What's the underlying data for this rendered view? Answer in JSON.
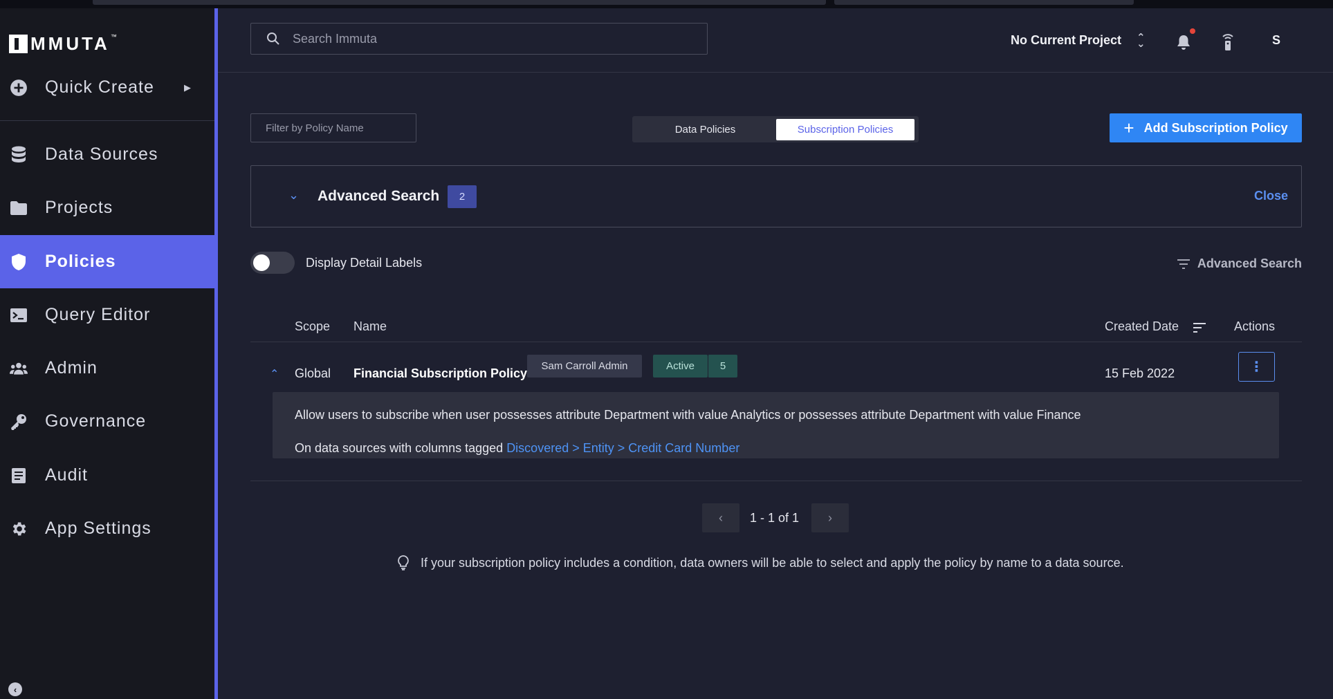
{
  "app": {
    "logo_text": "MMUTA",
    "logo_tm": "™"
  },
  "sidebar": {
    "items": [
      {
        "label": "Quick Create",
        "icon": "plus-circle-icon"
      },
      {
        "label": "Data Sources",
        "icon": "database-icon"
      },
      {
        "label": "Projects",
        "icon": "folder-icon"
      },
      {
        "label": "Policies",
        "icon": "shield-icon",
        "active": true
      },
      {
        "label": "Query Editor",
        "icon": "terminal-icon"
      },
      {
        "label": "Admin",
        "icon": "users-icon"
      },
      {
        "label": "Governance",
        "icon": "key-icon"
      },
      {
        "label": "Audit",
        "icon": "audit-icon"
      },
      {
        "label": "App Settings",
        "icon": "gear-icon"
      }
    ]
  },
  "header": {
    "search_placeholder": "Search Immuta",
    "project": "No Current Project",
    "user_initial": "S"
  },
  "toolbar": {
    "filter_placeholder": "Filter by Policy Name",
    "tab_data": "Data Policies",
    "tab_subscription": "Subscription Policies",
    "add_button": "Add Subscription Policy"
  },
  "advanced": {
    "title": "Advanced Search",
    "count": "2",
    "close": "Close",
    "toggle_label": "Display Detail Labels",
    "link": "Advanced Search"
  },
  "table": {
    "headers": {
      "scope": "Scope",
      "name": "Name",
      "created": "Created Date",
      "actions": "Actions"
    },
    "rows": [
      {
        "scope": "Global",
        "name": "Financial Subscription Policy",
        "owner": "Sam Carroll Admin",
        "status": "Active",
        "count": "5",
        "created": "15 Feb 2022",
        "detail_line1": "Allow users to subscribe when user possesses attribute Department with value Analytics or possesses attribute Department with value Finance",
        "detail_line2_prefix": "On data sources with columns tagged",
        "detail_line2_link": "Discovered > Entity > Credit Card Number"
      }
    ]
  },
  "pager": {
    "text": "1 - 1 of 1"
  },
  "hint": "If your subscription policy includes a condition, data owners will be able to select and apply the policy by name to a data source.",
  "colors": {
    "accent": "#5b63e8",
    "primary_button": "#2f86f4",
    "link": "#4e93f5",
    "status_bg": "#24524f"
  }
}
